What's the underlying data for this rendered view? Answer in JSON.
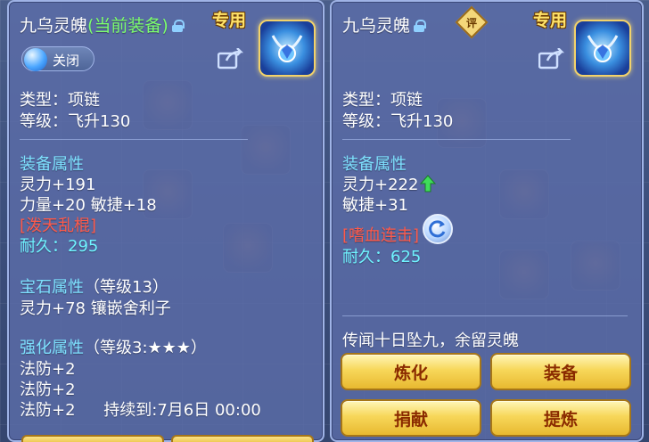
{
  "left_panel": {
    "name": "九乌灵魄",
    "name_suffix": "(当前装备)",
    "exclusive": "专用",
    "toggle_label": "关闭",
    "type": "类型：项链",
    "level": "等级：飞升130",
    "equip_header": "装备属性",
    "stat1": "灵力+191",
    "stat2": "力量+20 敏捷+18",
    "special": "[泼天乱棍]",
    "durability": "耐久：295",
    "gem_header": "宝石属性",
    "gem_level": "（等级13）",
    "gem_stat": "灵力+78 镶嵌舍利子",
    "enhance_header": "强化属性",
    "enhance_level": "（等级3:★★★）",
    "enh1": "法防+2",
    "enh2": "法防+2",
    "enh3": "法防+2",
    "enh3_expire": "持续到:7月6日 00:00"
  },
  "right_panel": {
    "name": "九乌灵魄",
    "eval_label": "评",
    "exclusive": "专用",
    "type": "类型：项链",
    "level": "等级：飞升130",
    "equip_header": "装备属性",
    "stat1": "灵力+222",
    "stat2": "敏捷+31",
    "special": "[嗜血连击]",
    "durability": "耐久：625",
    "lore": "传闻十日坠九，余留灵魄",
    "buttons": [
      "炼化",
      "装备",
      "捐献",
      "提炼"
    ]
  },
  "colors": {
    "accent_green": "#7dff6e",
    "header_blue": "#7ee1ff",
    "special_red": "#ff5a4a",
    "durability_cyan": "#6ff3ff",
    "button_gold": "#f7d75a"
  }
}
